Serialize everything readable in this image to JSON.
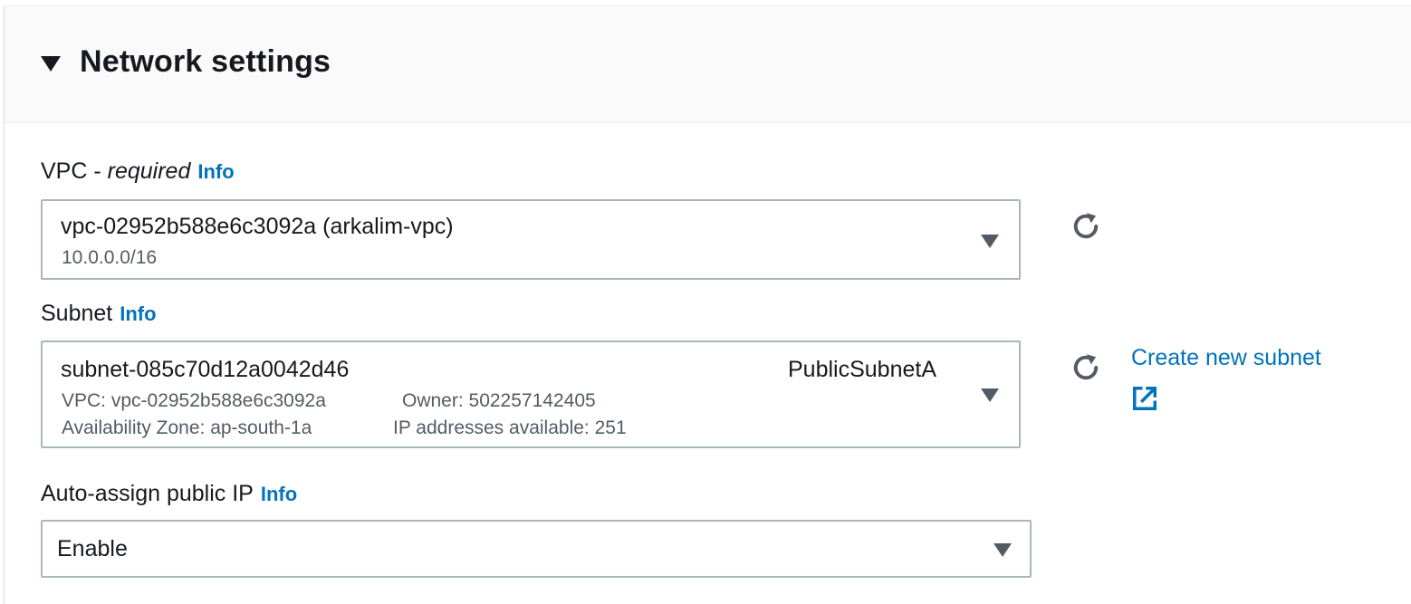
{
  "section": {
    "title": "Network settings",
    "icon": "caret-down-icon"
  },
  "vpc": {
    "label": "VPC - ",
    "required": "required",
    "info": "Info",
    "value": "vpc-02952b588e6c3092a (arkalim-vpc)",
    "cidr": "10.0.0.0/16",
    "refresh_icon": "refresh-icon"
  },
  "subnet": {
    "label": "Subnet",
    "info": "Info",
    "value": "subnet-085c70d12a0042d46",
    "name": "PublicSubnetA",
    "vpc_line": "VPC: vpc-02952b588e6c3092a",
    "owner_line": "Owner: 502257142405",
    "az_line": "Availability Zone: ap-south-1a",
    "ip_line": "IP addresses available: 251",
    "create_link": "Create new subnet",
    "refresh_icon": "refresh-icon",
    "external_icon": "external-link-icon"
  },
  "public_ip": {
    "label": "Auto-assign public IP",
    "info": "Info",
    "value": "Enable"
  },
  "colors": {
    "link": "#0073bb",
    "text": "#16191f",
    "secondary_text": "#545b64",
    "border": "#aab7b8",
    "header_bg": "#fafafa"
  }
}
